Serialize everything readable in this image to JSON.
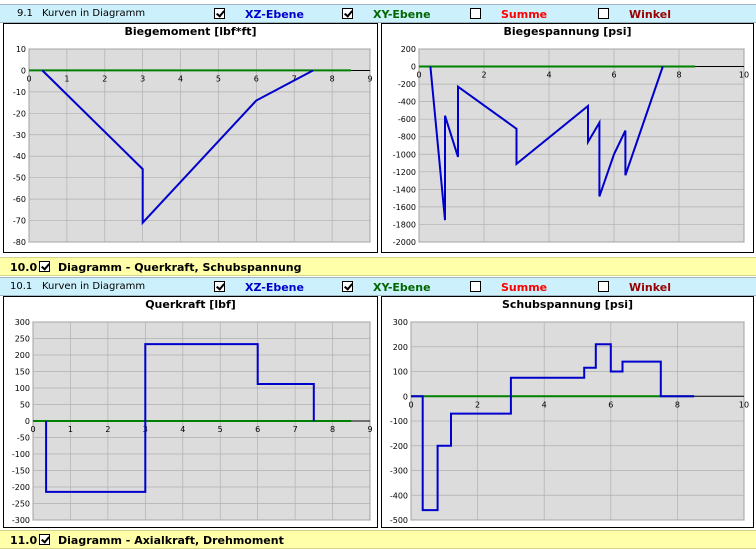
{
  "section91": {
    "num": "9.1",
    "label": "Kurven in Diagramm",
    "options": [
      {
        "label": "XZ-Ebene",
        "checked": true,
        "color": "#0000cc"
      },
      {
        "label": "XY-Ebene",
        "checked": true,
        "color": "#006600"
      },
      {
        "label": "Summe",
        "checked": false,
        "color": "#ff0000"
      },
      {
        "label": "Winkel",
        "checked": false,
        "color": "#990000"
      }
    ]
  },
  "header10": {
    "num": "10.0",
    "checked": true,
    "title": "Diagramm - Querkraft, Schubspannung"
  },
  "section101": {
    "num": "10.1",
    "label": "Kurven in Diagramm",
    "options": [
      {
        "label": "XZ-Ebene",
        "checked": true,
        "color": "#0000cc"
      },
      {
        "label": "XY-Ebene",
        "checked": true,
        "color": "#006600"
      },
      {
        "label": "Summe",
        "checked": false,
        "color": "#ff0000"
      },
      {
        "label": "Winkel",
        "checked": false,
        "color": "#990000"
      }
    ]
  },
  "header11": {
    "num": "11.0",
    "checked": true,
    "title": "Diagramm - Axialkraft,  Drehmoment"
  },
  "colors": {
    "xz": "#0000cc",
    "xy": "#008000",
    "plot_bg": "#dcdcdc",
    "grid": "#b0b0b0"
  },
  "chart_data": [
    {
      "type": "line",
      "title": "Biegemoment [lbf*ft]",
      "xlim": [
        0,
        9
      ],
      "ylim": [
        -80,
        10
      ],
      "xticks": [
        0,
        1,
        2,
        3,
        4,
        5,
        6,
        7,
        8,
        9
      ],
      "yticks": [
        10,
        0,
        -10,
        -20,
        -30,
        -40,
        -50,
        -60,
        -70,
        -80
      ],
      "series": [
        {
          "key": "xz",
          "x": [
            0.35,
            3.0,
            3.0,
            6.0,
            7.5
          ],
          "y": [
            0,
            -46,
            -71,
            -14,
            0
          ]
        },
        {
          "key": "xy",
          "x": [
            0,
            8.5
          ],
          "y": [
            0,
            0
          ]
        }
      ]
    },
    {
      "type": "line",
      "title": "Biegespannung [psi]",
      "xlim": [
        0,
        10
      ],
      "ylim": [
        -2000,
        200
      ],
      "xticks": [
        0,
        2,
        4,
        6,
        8,
        10
      ],
      "yticks": [
        200,
        0,
        -200,
        -400,
        -600,
        -800,
        -1000,
        -1200,
        -1400,
        -1600,
        -1800,
        -2000
      ],
      "series": [
        {
          "key": "xz",
          "x": [
            0.35,
            0.8,
            0.8,
            1.2,
            1.2,
            3.0,
            3.0,
            5.2,
            5.2,
            5.55,
            5.55,
            6.0,
            6.0,
            6.35,
            6.35,
            7.5
          ],
          "y": [
            0,
            -1750,
            -560,
            -1030,
            -230,
            -710,
            -1110,
            -450,
            -860,
            -640,
            -1480,
            -1000,
            -1000,
            -730,
            -1240,
            0
          ]
        },
        {
          "key": "xy",
          "x": [
            0,
            8.5
          ],
          "y": [
            0,
            0
          ]
        }
      ]
    },
    {
      "type": "line",
      "title": "Querkraft [lbf]",
      "xlim": [
        0,
        9
      ],
      "ylim": [
        -300,
        300
      ],
      "xticks": [
        0,
        1,
        2,
        3,
        4,
        5,
        6,
        7,
        8,
        9
      ],
      "yticks": [
        300,
        250,
        200,
        150,
        100,
        50,
        0,
        -50,
        -100,
        -150,
        -200,
        -250,
        -300
      ],
      "series": [
        {
          "key": "xz",
          "x": [
            0.35,
            0.35,
            3.0,
            3.0,
            6.0,
            6.0,
            7.5,
            7.5
          ],
          "y": [
            0,
            -215,
            -215,
            233,
            233,
            112,
            112,
            0
          ]
        },
        {
          "key": "xy",
          "x": [
            0,
            8.5
          ],
          "y": [
            0,
            0
          ]
        }
      ]
    },
    {
      "type": "line",
      "title": "Schubspannung [psi]",
      "xlim": [
        0,
        10
      ],
      "ylim": [
        -500,
        300
      ],
      "xticks": [
        0,
        2,
        4,
        6,
        8,
        10
      ],
      "yticks": [
        300,
        200,
        100,
        0,
        -100,
        -200,
        -300,
        -400,
        -500
      ],
      "series": [
        {
          "key": "xz",
          "x": [
            0,
            0.35,
            0.35,
            0.8,
            0.8,
            1.2,
            1.2,
            3.0,
            3.0,
            5.2,
            5.2,
            5.55,
            5.55,
            6.0,
            6.0,
            6.35,
            6.35,
            7.5,
            7.5,
            8.5
          ],
          "y": [
            0,
            0,
            -460,
            -460,
            -200,
            -200,
            -70,
            -70,
            75,
            75,
            115,
            115,
            210,
            210,
            100,
            100,
            140,
            140,
            0,
            0
          ]
        },
        {
          "key": "xy",
          "x": [
            0,
            8.5
          ],
          "y": [
            0,
            0
          ]
        }
      ]
    }
  ]
}
